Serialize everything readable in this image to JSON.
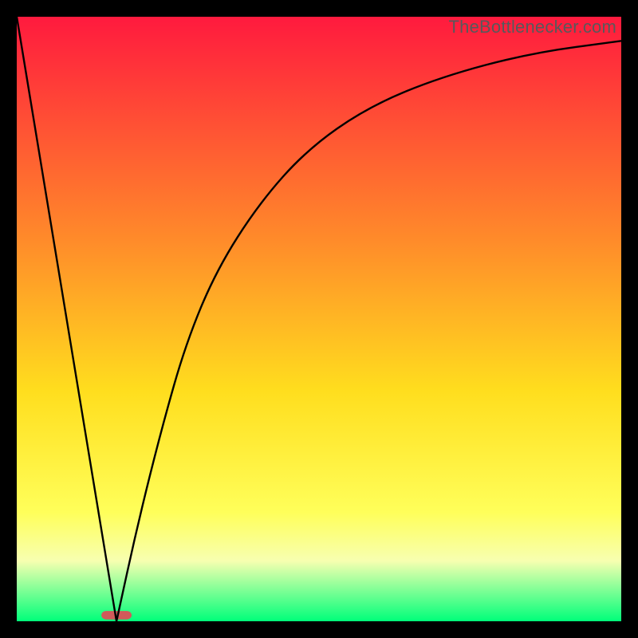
{
  "watermark": "TheBottlenecker.com",
  "chart_data": {
    "type": "line",
    "title": "",
    "xlabel": "",
    "ylabel": "",
    "xlim": [
      0,
      100
    ],
    "ylim": [
      0,
      100
    ],
    "background_gradient": {
      "top_color": "#ff1a3e",
      "mid_upper_color": "#ff8b2a",
      "mid_color": "#ffde1e",
      "mid_lower_color": "#ffff5a",
      "bottom_color": "#00ff7a"
    },
    "marker": {
      "x": 16.5,
      "y": 1.0,
      "width": 5.0,
      "height": 1.4,
      "color": "#d15a5a"
    },
    "series": [
      {
        "name": "bottleneck-left",
        "type": "line",
        "color": "#000000",
        "x": [
          0,
          16.5
        ],
        "y": [
          100,
          0
        ]
      },
      {
        "name": "bottleneck-right",
        "type": "curve",
        "color": "#000000",
        "points": [
          {
            "x": 16.5,
            "y": 0
          },
          {
            "x": 20,
            "y": 16
          },
          {
            "x": 24,
            "y": 32
          },
          {
            "x": 28,
            "y": 46
          },
          {
            "x": 33,
            "y": 58
          },
          {
            "x": 40,
            "y": 69
          },
          {
            "x": 48,
            "y": 78
          },
          {
            "x": 58,
            "y": 85
          },
          {
            "x": 70,
            "y": 90
          },
          {
            "x": 85,
            "y": 94
          },
          {
            "x": 100,
            "y": 96
          }
        ]
      }
    ]
  }
}
